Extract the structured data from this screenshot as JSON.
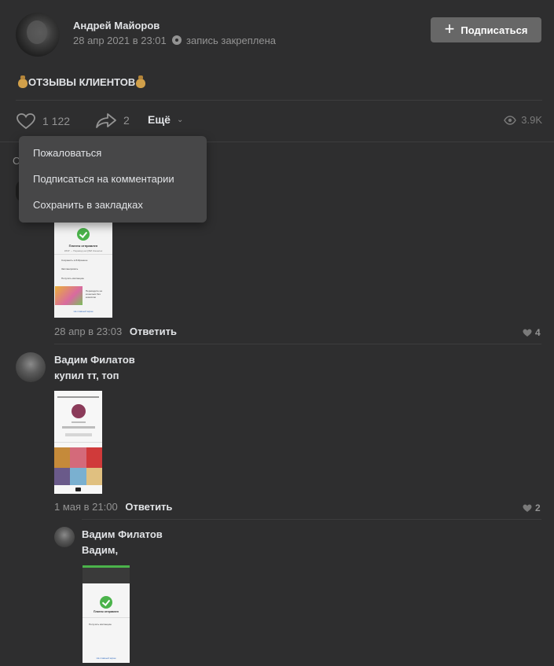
{
  "post": {
    "author": "Андрей Майоров",
    "date": "28 апр 2021 в 23:01",
    "pinned_label": "запись закреплена",
    "subscribe_label": "Подписаться",
    "text": "ОТЗЫВЫ КЛИЕНТОВ",
    "likes": "1 122",
    "shares": "2",
    "more_label": "Ещё",
    "views": "3.9K"
  },
  "menu": {
    "items": [
      "Пожаловаться",
      "Подписаться на комментарии",
      "Сохранить в закладках"
    ]
  },
  "comments_header_partial": "С",
  "comments": [
    {
      "date": "28 апр в 23:03",
      "reply_label": "Ответить",
      "likes": "4",
      "screenshot_text": {
        "title": "Платеж отправлен",
        "sub": "КЮР → Перевод на QIWI Кошелек",
        "opt1": "Сохранить в Избранное",
        "opt2": "Запланировать",
        "opt3": "Получить квитанцию",
        "promo": "Переводите на кошельки без комиссии",
        "footer": "На главный экран"
      }
    },
    {
      "author": "Вадим Филатов",
      "text": "купил тт, топ",
      "date": "1 мая в 21:00",
      "reply_label": "Ответить",
      "likes": "2"
    },
    {
      "author": "Вадим Филатов",
      "text": "Вадим,",
      "screenshot_text": {
        "title": "Платеж отправлен",
        "opt": "Получить квитанцию",
        "footer": "На главный экран"
      }
    }
  ]
}
